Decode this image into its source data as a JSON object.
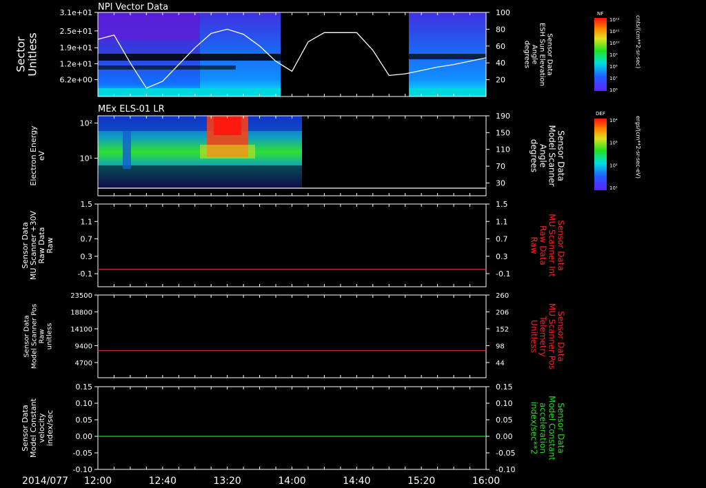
{
  "chart_data": [
    {
      "type": "heatmap",
      "title": "NPI Vector Data",
      "ylabel_left": [
        "Sector",
        "Unitless"
      ],
      "yticks_left": [
        "3.1e+01",
        "2.5e+01",
        "1.9e+01",
        "1.2e+01",
        "6.2e+00"
      ],
      "ylabel_right": [
        "Sensor Data",
        "ESH Sun Elevation",
        "Angle",
        "degrees"
      ],
      "yticks_right": [
        "100",
        "80",
        "60",
        "40",
        "20"
      ],
      "ylim_right": [
        0,
        100
      ],
      "overlay_line": {
        "color": "#ffffff",
        "x_min": [
          0,
          10,
          20,
          30,
          40,
          50,
          60,
          70,
          80,
          90,
          100,
          110,
          120,
          130,
          140,
          150,
          160,
          170,
          180,
          190,
          200,
          210,
          220,
          230,
          240
        ],
        "y_deg": [
          68,
          73,
          40,
          10,
          18,
          38,
          58,
          75,
          80,
          74,
          60,
          42,
          30,
          65,
          76,
          76,
          76,
          55,
          25,
          27,
          31,
          35,
          38,
          42,
          46
        ]
      },
      "colorbar": {
        "label": "NF",
        "ticks": [
          "10¹²",
          "10¹¹",
          "10¹⁰",
          "10⁹",
          "10⁸",
          "10⁷",
          "10⁶"
        ],
        "unit": "cnts/(cm**2-sr-sec)"
      }
    },
    {
      "type": "heatmap",
      "title": "MEx ELS-01 LR",
      "ylabel_left": [
        "Electron Energy",
        "eV"
      ],
      "yticks_left": [
        "10²",
        "10¹"
      ],
      "ylabel_right": [
        "Sensor Data",
        "Model Scanner",
        "Angle",
        "degrees"
      ],
      "yticks_right": [
        "190",
        "150",
        "110",
        "70",
        "30"
      ],
      "ylim_right": [
        0,
        190
      ],
      "overlay_line": {
        "color": "#ffffff",
        "value": 0
      },
      "colorbar": {
        "label": "DEF",
        "ticks": [
          "10⁴",
          "10³",
          "10²",
          "10¹"
        ],
        "unit": "ergs/(cm**2-sr-sec-eV)"
      }
    },
    {
      "type": "line",
      "ylabel_left": [
        "Sensor Data",
        "MU Scanner +30V",
        "Raw Data",
        "Raw"
      ],
      "yticks_left": [
        "1.5",
        "1.1",
        "0.7",
        "0.3",
        "-0.1"
      ],
      "ylabel_right": [
        "Sensor Data",
        "MU Scanner Int",
        "Raw Data",
        "Raw"
      ],
      "yticks_right": [
        "1.5",
        "1.1",
        "0.7",
        "0.3",
        "-0.1"
      ],
      "ylim": [
        -0.4,
        1.5
      ],
      "series": [
        {
          "color": "#e03030",
          "value": 0
        }
      ]
    },
    {
      "type": "line",
      "ylabel_left": [
        "Sensor Data",
        "Model Scanner Pos",
        "Raw",
        "unitless"
      ],
      "yticks_left": [
        "23500",
        "18800",
        "14100",
        "9400",
        "4700"
      ],
      "ylabel_right": [
        "Sensor Data",
        "MU Scanner Pos",
        "Telemetry",
        "Unitless"
      ],
      "yticks_right": [
        "260",
        "206",
        "152",
        "98",
        "44"
      ],
      "ylim": [
        0,
        23500
      ],
      "series": [
        {
          "color": "#e03030",
          "value": 7700
        }
      ]
    },
    {
      "type": "line",
      "ylabel_left": [
        "Sensor Data",
        "Model Constant",
        "velocity",
        "index/sec"
      ],
      "yticks_left": [
        "0.15",
        "0.10",
        "0.05",
        "0.00",
        "-0.05",
        "-0.10"
      ],
      "ylabel_right": [
        "Sensor Data",
        "Model Constant",
        "acceleration",
        "index/sec**2"
      ],
      "yticks_right": [
        "0.15",
        "0.10",
        "0.05",
        "0.00",
        "-0.05",
        "-0.10"
      ],
      "ylim": [
        -0.1,
        0.15
      ],
      "series": [
        {
          "color": "#22dd22",
          "value": 0.0
        }
      ]
    }
  ],
  "x_axis": {
    "date_label": "2014/077",
    "ticks": [
      "12:00",
      "12:40",
      "13:20",
      "14:00",
      "14:40",
      "15:20",
      "16:00"
    ],
    "range_minutes": [
      0,
      240
    ]
  },
  "colors": {
    "right_label_red": "#ff2020",
    "right_label_green": "#22dd22"
  }
}
